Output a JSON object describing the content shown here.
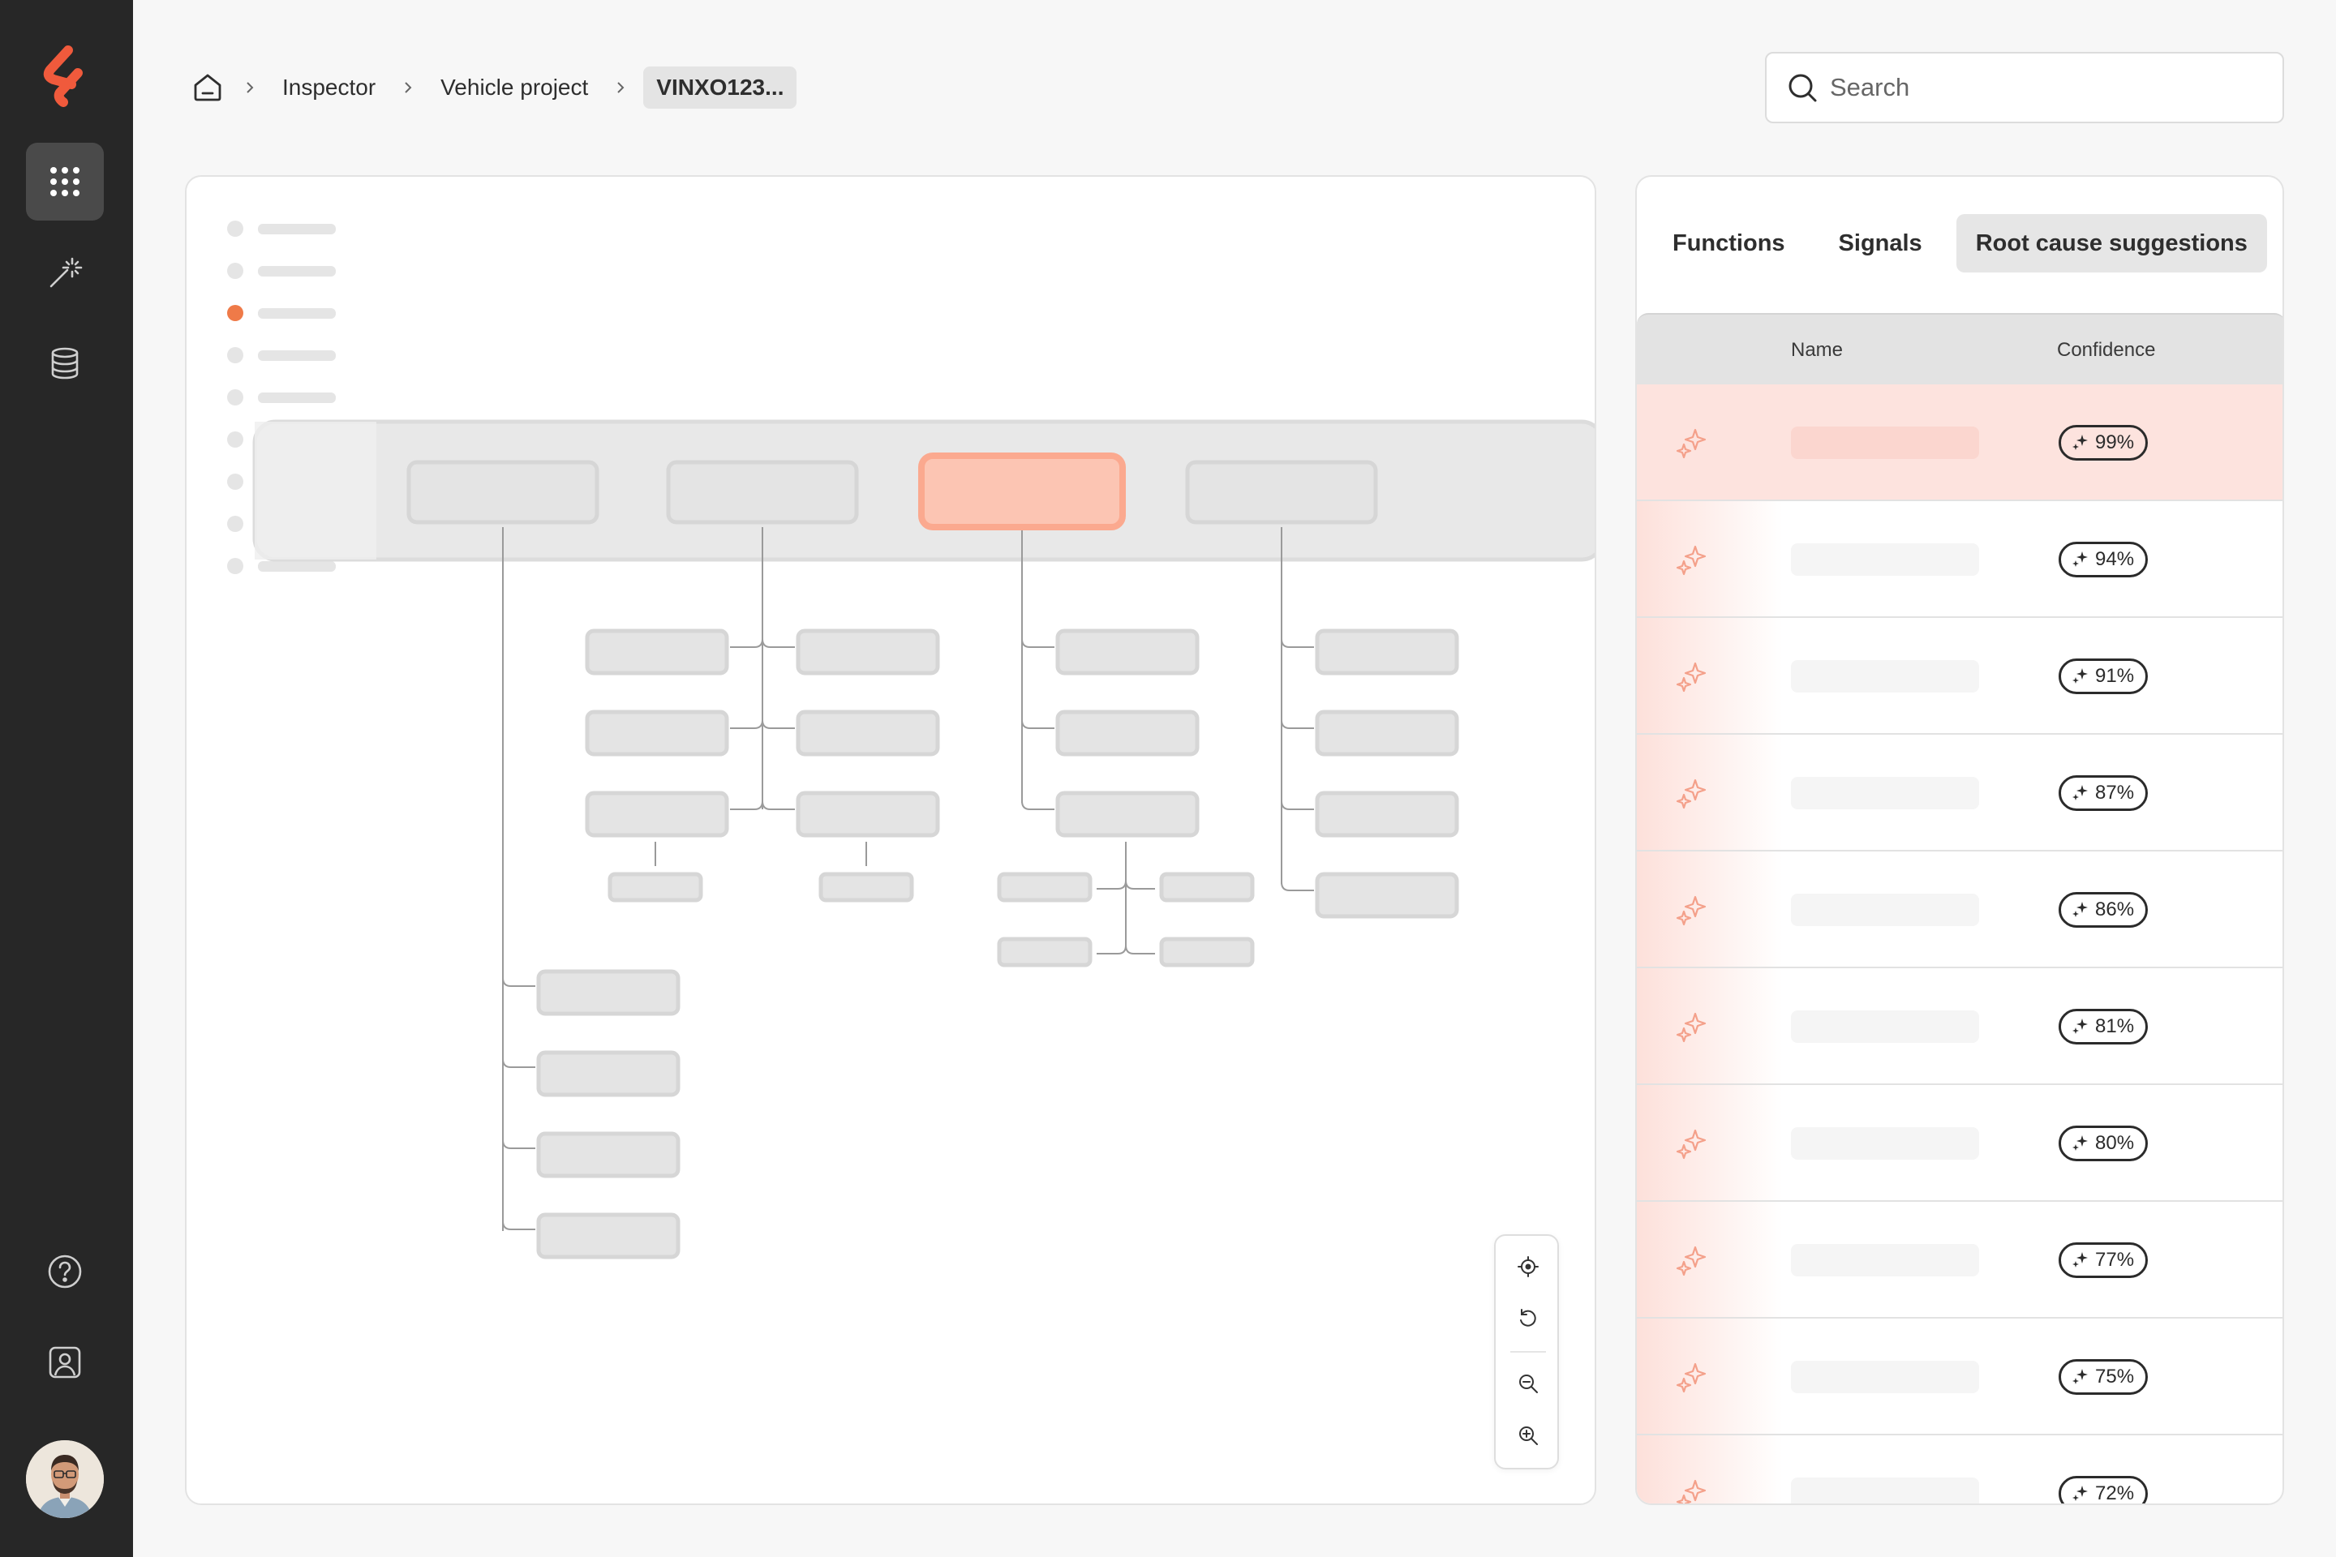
{
  "breadcrumb": {
    "home_icon": "home-icon",
    "items": [
      "Inspector",
      "Vehicle project"
    ],
    "current": "VINXO123..."
  },
  "search": {
    "placeholder": "Search"
  },
  "sidebar": {
    "items": [
      "apps-grid-icon",
      "magic-wand-icon",
      "database-icon"
    ],
    "bottom": [
      "help-icon",
      "user-profile-icon"
    ],
    "accent": "#f05a3c"
  },
  "tabs": {
    "functions": "Functions",
    "signals": "Signals",
    "root_cause": "Root cause suggestions"
  },
  "table": {
    "col_name": "Name",
    "col_confidence": "Confidence",
    "rows": [
      {
        "confidence": "99%"
      },
      {
        "confidence": "94%"
      },
      {
        "confidence": "91%"
      },
      {
        "confidence": "87%"
      },
      {
        "confidence": "86%"
      },
      {
        "confidence": "81%"
      },
      {
        "confidence": "80%"
      },
      {
        "confidence": "77%"
      },
      {
        "confidence": "75%"
      },
      {
        "confidence": "72%"
      }
    ]
  },
  "colors": {
    "highlight": "#fcc5b3",
    "highlight_border": "#fba98f",
    "row_highlight": "#fde3de",
    "node": "#e5e5e5"
  }
}
